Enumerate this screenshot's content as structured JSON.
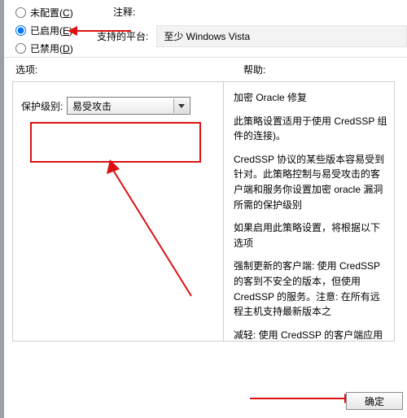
{
  "radios": {
    "not_configured": {
      "label": "未配置",
      "key": "C",
      "checked": false
    },
    "enabled": {
      "label": "已启用",
      "key": "E",
      "checked": true
    },
    "disabled": {
      "label": "已禁用",
      "key": "D",
      "checked": false
    }
  },
  "notes": {
    "label": "注释:"
  },
  "platform": {
    "label": "支持的平台:",
    "value": "至少 Windows Vista"
  },
  "section": {
    "options": "选项:",
    "help": "帮助:"
  },
  "option": {
    "label": "保护级别:",
    "selected": "易受攻击",
    "values": [
      "易受攻击"
    ]
  },
  "help": {
    "title": "加密 Oracle 修复",
    "p1": "此策略设置适用于使用 CredSSP 组件的连接)。",
    "p2": "CredSSP 协议的某些版本容易受到针对。此策略控制与易受攻击的客户端和服务你设置加密 oracle 漏洞所需的保护级别",
    "p3": "如果启用此策略设置，将根据以下选项",
    "p4": "强制更新的客户端: 使用 CredSSP 的客到不安全的版本，但使用 CredSSP 的服务。注意: 在所有远程主机支持最新版本之",
    "p5": "减轻: 使用 CredSSP 的客户端应用程序本，但使用 CredSSP 的服务将接受未修补客户端所造成的风险的更多信息，请"
  },
  "buttons": {
    "ok": "确定"
  },
  "chart_data": null
}
